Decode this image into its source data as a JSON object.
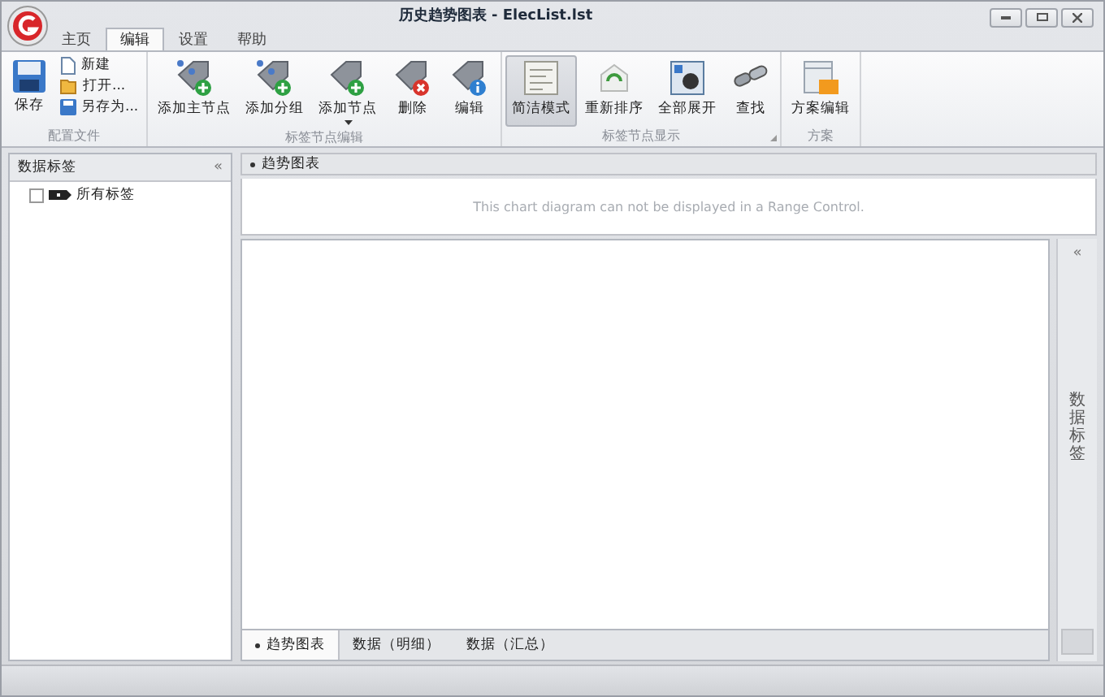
{
  "window": {
    "title": "历史趋势图表 - ElecList.lst"
  },
  "ribbon": {
    "tabs": [
      {
        "label": "主页",
        "selected": false
      },
      {
        "label": "编辑",
        "selected": true
      },
      {
        "label": "设置",
        "selected": false
      },
      {
        "label": "帮助",
        "selected": false
      }
    ],
    "groups": [
      {
        "label": "配置文件",
        "launcher": false,
        "items": [
          {
            "kind": "large",
            "label": "保存",
            "pressed": false,
            "dropdown": false
          },
          {
            "kind": "stack",
            "items": [
              {
                "label": "新建"
              },
              {
                "label": "打开..."
              },
              {
                "label": "另存为..."
              }
            ]
          }
        ]
      },
      {
        "label": "标签节点编辑",
        "launcher": false,
        "items": [
          {
            "kind": "large",
            "label": "添加主节点",
            "pressed": false,
            "dropdown": false
          },
          {
            "kind": "large",
            "label": "添加分组",
            "pressed": false,
            "dropdown": false
          },
          {
            "kind": "large",
            "label": "添加节点",
            "pressed": false,
            "dropdown": true
          },
          {
            "kind": "large",
            "label": "删除",
            "pressed": false,
            "dropdown": false
          },
          {
            "kind": "large",
            "label": "编辑",
            "pressed": false,
            "dropdown": false
          }
        ]
      },
      {
        "label": "标签节点显示",
        "launcher": true,
        "items": [
          {
            "kind": "large",
            "label": "简洁模式",
            "pressed": true,
            "dropdown": false
          },
          {
            "kind": "large",
            "label": "重新排序",
            "pressed": false,
            "dropdown": false
          },
          {
            "kind": "large",
            "label": "全部展开",
            "pressed": false,
            "dropdown": false
          },
          {
            "kind": "large",
            "label": "查找",
            "pressed": false,
            "dropdown": false
          }
        ]
      },
      {
        "label": "方案",
        "launcher": false,
        "items": [
          {
            "kind": "large",
            "label": "方案编辑",
            "pressed": false,
            "dropdown": false
          }
        ]
      }
    ]
  },
  "left_panel": {
    "title": "数据标签",
    "collapse": "«",
    "tree": [
      {
        "label": "所有标签",
        "checked": false
      }
    ]
  },
  "chart_panel": {
    "title": "趋势图表",
    "range_message": "This chart diagram can not be displayed in a Range Control."
  },
  "right_panel": {
    "collapse": "«",
    "title": "数据标签"
  },
  "bottom_tabs": [
    {
      "label": "趋势图表",
      "selected": true
    },
    {
      "label": "数据（明细）",
      "selected": false
    },
    {
      "label": "数据（汇总）",
      "selected": false
    }
  ]
}
